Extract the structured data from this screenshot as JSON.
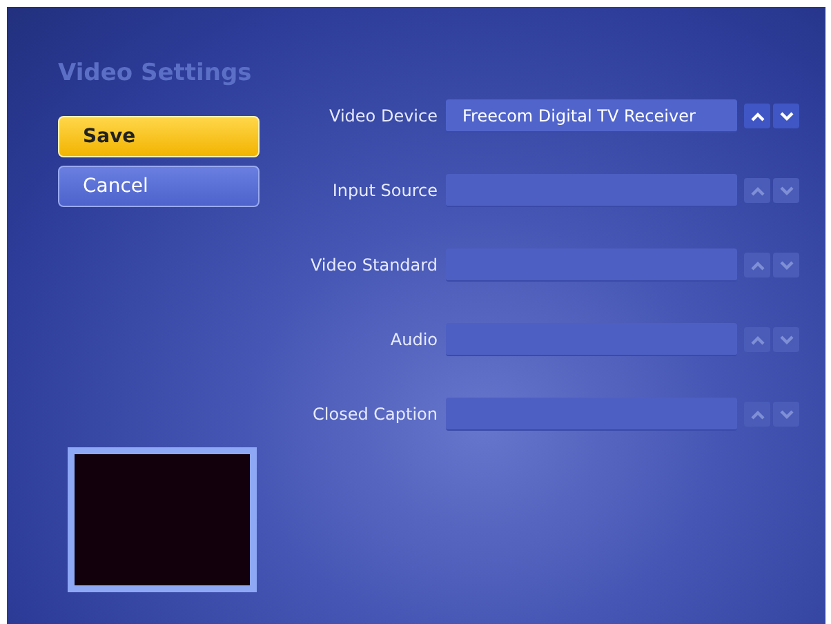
{
  "title": "Video Settings",
  "buttons": [
    {
      "label": "Save",
      "selected": true
    },
    {
      "label": "Cancel",
      "selected": false
    }
  ],
  "settings": [
    {
      "label": "Video Device",
      "value": "Freecom Digital TV Receiver",
      "disabled": false
    },
    {
      "label": "Input Source",
      "disabled": true
    },
    {
      "label": "Video Standard",
      "disabled": true
    },
    {
      "label": "Audio",
      "disabled": true
    },
    {
      "label": "Closed Caption",
      "disabled": true
    }
  ]
}
